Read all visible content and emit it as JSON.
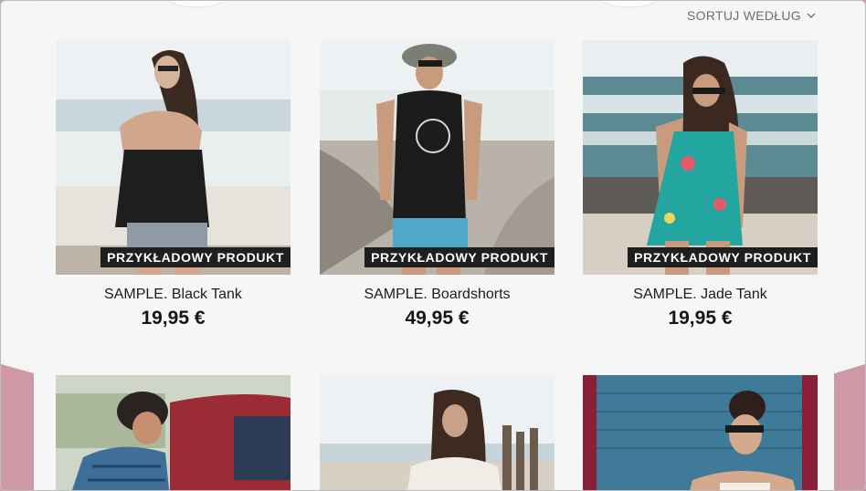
{
  "sort": {
    "label": "SORTUJ WEDŁUG",
    "icon": "chevron-down-icon"
  },
  "badge_label": "PRZYKŁADOWY PRODUKT",
  "products": [
    {
      "title": "SAMPLE. Black Tank",
      "price": "19,95 €"
    },
    {
      "title": "SAMPLE. Boardshorts",
      "price": "49,95 €"
    },
    {
      "title": "SAMPLE. Jade Tank",
      "price": "19,95 €"
    }
  ],
  "colors": {
    "badge_bg": "#1f1f1f",
    "side_accent": "#cf98a6",
    "background": "#f6f6f6"
  }
}
